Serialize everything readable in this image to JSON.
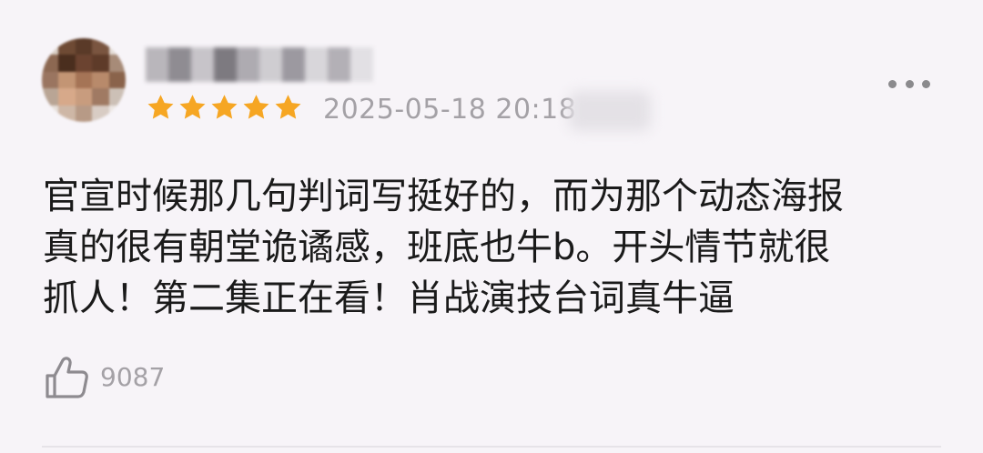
{
  "comment": {
    "rating": 5,
    "rating_max": 5,
    "timestamp": "2025-05-18 20:18",
    "lines": [
      "官宣时候那几句判词写挺好的，而为那个动态海报",
      "真的很有朝堂诡谲感，班底也牛b。开头情节就很",
      "抓人！第二集正在看！肖战演技台词真牛逼"
    ],
    "likes": "9087"
  },
  "colors": {
    "star": "#f6a623",
    "meta_text": "#a4a1a6",
    "body_text": "#1a1a1a",
    "background": "#f7f4f8"
  },
  "icons": {
    "rating": "star-icon",
    "more": "more-dots-icon",
    "like": "thumbs-up-icon"
  }
}
